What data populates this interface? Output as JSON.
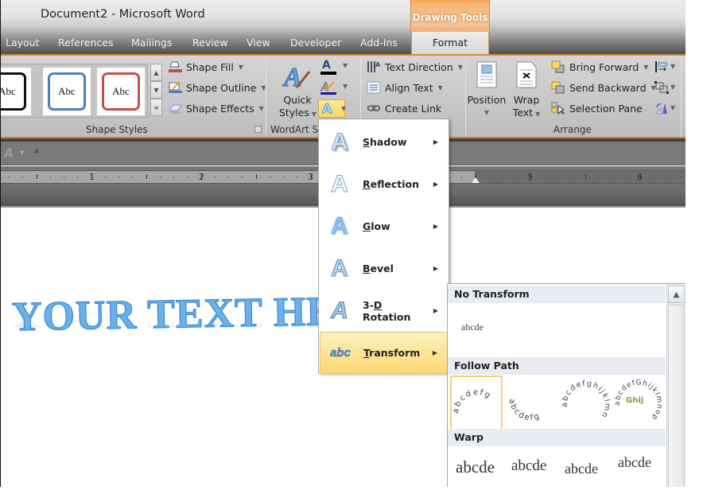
{
  "window": {
    "title": "Document2  -  Microsoft Word"
  },
  "tabs": [
    {
      "label": "Layout"
    },
    {
      "label": "References"
    },
    {
      "label": "Mailings"
    },
    {
      "label": "Review"
    },
    {
      "label": "View"
    },
    {
      "label": "Developer"
    },
    {
      "label": "Add-Ins"
    }
  ],
  "contextual_tab": {
    "group_label": "Drawing Tools",
    "tab_label": "Format",
    "accent_color": "#f7b676"
  },
  "ribbon": {
    "shape_styles": {
      "group_label": "Shape Styles",
      "swatches": [
        {
          "text": "Abc",
          "border_color": "#111111"
        },
        {
          "text": "Abc",
          "border_color": "#4f81bd"
        },
        {
          "text": "Abc",
          "border_color": "#c0504d"
        }
      ],
      "buttons": [
        {
          "label": "Shape Fill",
          "icon": "paint-bucket-icon"
        },
        {
          "label": "Shape Outline",
          "icon": "pencil-outline-icon"
        },
        {
          "label": "Shape Effects",
          "icon": "shape-effects-icon"
        }
      ]
    },
    "wordart_styles": {
      "group_label": "WordArt S",
      "quick_styles_label_1": "Quick",
      "quick_styles_label_2": "Styles",
      "text_fill_glyph": "A",
      "text_effects_glyph": "A"
    },
    "text": {
      "buttons": [
        {
          "label": "Text Direction",
          "icon": "text-direction-icon",
          "has_dropdown": true
        },
        {
          "label": "Align Text",
          "icon": "align-text-icon",
          "has_dropdown": true
        },
        {
          "label": "Create Link",
          "icon": "link-icon",
          "has_dropdown": false
        }
      ]
    },
    "arrange": {
      "group_label": "Arrange",
      "position_label": "Position",
      "wrap_label_1": "Wrap",
      "wrap_label_2": "Text",
      "buttons": [
        {
          "label": "Bring Forward",
          "icon": "bring-forward-icon"
        },
        {
          "label": "Send Backward",
          "icon": "send-backward-icon"
        },
        {
          "label": "Selection Pane",
          "icon": "selection-pane-icon"
        }
      ]
    }
  },
  "ruler": {
    "numbers": [
      "1",
      "2",
      "3",
      "5",
      "6"
    ]
  },
  "document": {
    "wordart_text": "YOUR TEXT HERE"
  },
  "text_effects_menu": {
    "items": [
      {
        "label": "Shadow",
        "mnemonic": "S"
      },
      {
        "label": "Reflection",
        "mnemonic": "R"
      },
      {
        "label": "Glow",
        "mnemonic": "G"
      },
      {
        "label": "Bevel",
        "mnemonic": "B"
      },
      {
        "label": "3-D Rotation",
        "mnemonic": "D"
      },
      {
        "label": "Transform",
        "mnemonic": "T",
        "active": true
      }
    ]
  },
  "transform_gallery": {
    "sections": [
      {
        "title": "No Transform",
        "sample": "abcde"
      },
      {
        "title": "Follow Path",
        "samples": [
          "abcdefg",
          "abcdefg",
          "abcdefghijklmn",
          "abcdefGhijklmnop"
        ]
      },
      {
        "title": "Warp",
        "samples": [
          "abcde",
          "abcde",
          "abcde",
          "abcde"
        ]
      }
    ]
  }
}
